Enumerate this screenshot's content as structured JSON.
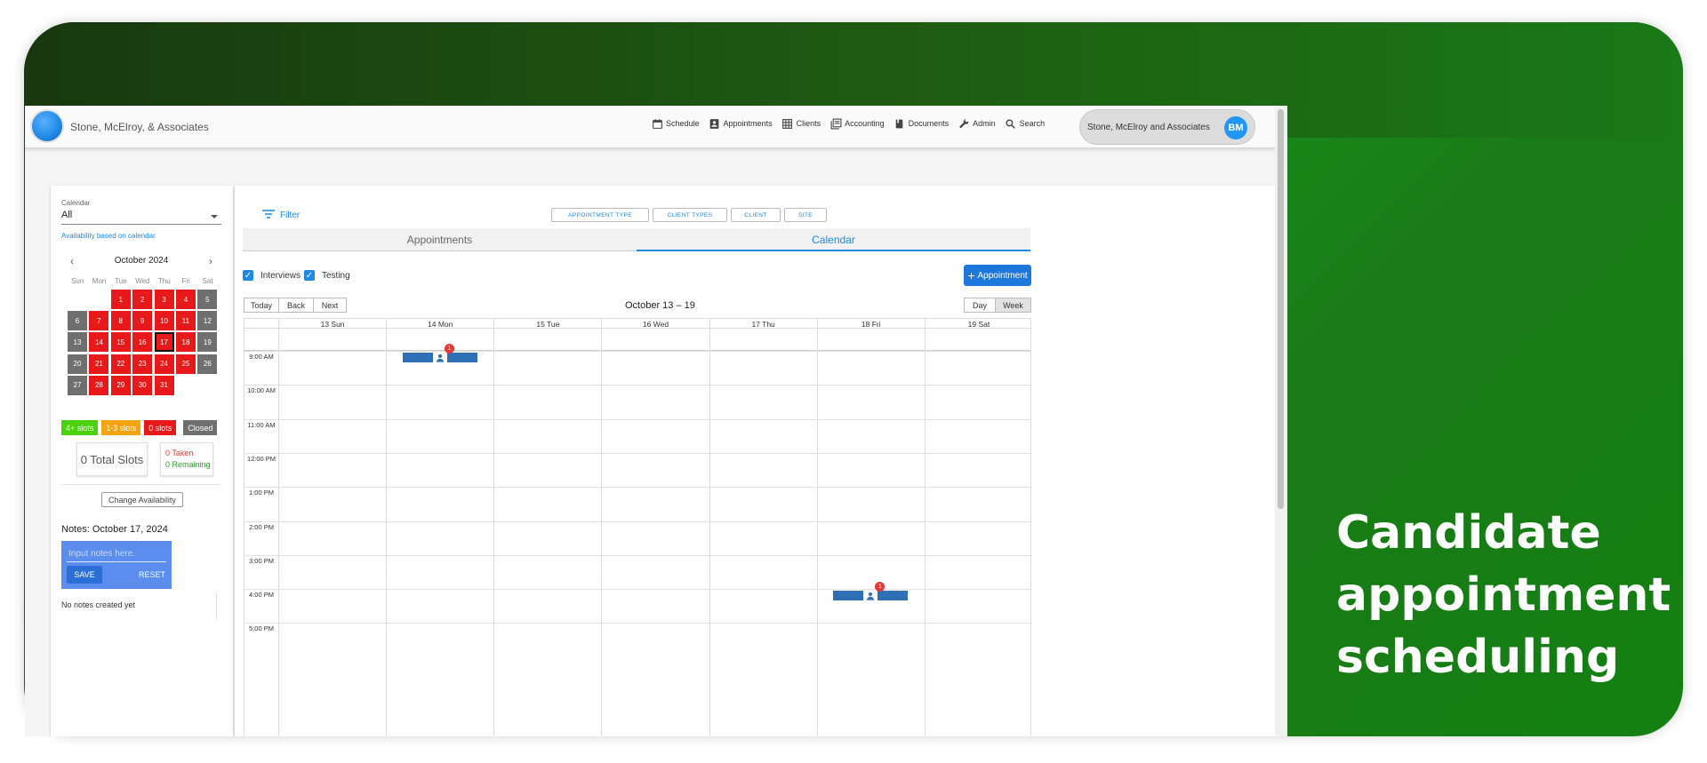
{
  "tagline": [
    "Candidate",
    "appointment",
    "scheduling"
  ],
  "header": {
    "firm_name": "Stone, McElroy, & Associates",
    "nav": [
      {
        "label": "Schedule",
        "icon": "calendar-icon"
      },
      {
        "label": "Appointments",
        "icon": "contact-card-icon"
      },
      {
        "label": "Clients",
        "icon": "grid-icon"
      },
      {
        "label": "Accounting",
        "icon": "ledger-icon"
      },
      {
        "label": "Documents",
        "icon": "book-icon"
      },
      {
        "label": "Admin",
        "icon": "wrench-icon"
      },
      {
        "label": "Search",
        "icon": "search-icon"
      }
    ],
    "account_name": "Stone, McElroy and Associates",
    "avatar_initials": "BM"
  },
  "sidebar": {
    "calendar_label": "Calendar",
    "calendar_value": "All",
    "availability_note": "Availability based on calendar",
    "month_title": "October 2024",
    "weekdays": [
      "Sun",
      "Mon",
      "Tue",
      "Wed",
      "Thu",
      "Fri",
      "Sat"
    ],
    "days": [
      {
        "n": "",
        "s": "empty"
      },
      {
        "n": "",
        "s": "empty"
      },
      {
        "n": "1",
        "s": "red"
      },
      {
        "n": "2",
        "s": "red"
      },
      {
        "n": "3",
        "s": "red"
      },
      {
        "n": "4",
        "s": "red"
      },
      {
        "n": "5",
        "s": "gray"
      },
      {
        "n": "6",
        "s": "gray"
      },
      {
        "n": "7",
        "s": "red"
      },
      {
        "n": "8",
        "s": "red"
      },
      {
        "n": "9",
        "s": "red"
      },
      {
        "n": "10",
        "s": "red"
      },
      {
        "n": "11",
        "s": "red"
      },
      {
        "n": "12",
        "s": "gray"
      },
      {
        "n": "13",
        "s": "gray"
      },
      {
        "n": "14",
        "s": "red"
      },
      {
        "n": "15",
        "s": "red"
      },
      {
        "n": "16",
        "s": "red"
      },
      {
        "n": "17",
        "s": "red",
        "selected": true
      },
      {
        "n": "18",
        "s": "red"
      },
      {
        "n": "19",
        "s": "gray"
      },
      {
        "n": "20",
        "s": "gray"
      },
      {
        "n": "21",
        "s": "red"
      },
      {
        "n": "22",
        "s": "red"
      },
      {
        "n": "23",
        "s": "red"
      },
      {
        "n": "24",
        "s": "red"
      },
      {
        "n": "25",
        "s": "red"
      },
      {
        "n": "26",
        "s": "gray"
      },
      {
        "n": "27",
        "s": "gray"
      },
      {
        "n": "28",
        "s": "red"
      },
      {
        "n": "29",
        "s": "red"
      },
      {
        "n": "30",
        "s": "red"
      },
      {
        "n": "31",
        "s": "red"
      }
    ],
    "legend": [
      {
        "label": "4+ slots",
        "color": "#4cd10f"
      },
      {
        "label": "1-3 slots",
        "color": "#f5a30f"
      },
      {
        "label": "0 slots",
        "color": "#e8191a"
      },
      {
        "label": "Closed",
        "color": "#6f6f6f"
      }
    ],
    "total_slots": "0 Total Slots",
    "taken": "0 Taken",
    "remaining": "0 Remaining",
    "change_availability": "Change Availability",
    "notes_title": "Notes: October 17, 2024",
    "notes_placeholder": "Input notes here.",
    "save_label": "SAVE",
    "reset_label": "RESET",
    "no_notes": "No notes created yet"
  },
  "main": {
    "filter_label": "Filter",
    "filter_chips": [
      "APPOINTMENT TYPE",
      "CLIENT TYPES",
      "CLIENT",
      "SITE"
    ],
    "tabs": [
      {
        "label": "Appointments",
        "active": false
      },
      {
        "label": "Calendar",
        "active": true
      }
    ],
    "checkboxes": [
      {
        "label": "Interviews",
        "checked": true
      },
      {
        "label": "Testing",
        "checked": true
      }
    ],
    "add_appointment_label": "Appointment",
    "nav_buttons": [
      "Today",
      "Back",
      "Next"
    ],
    "range_label": "October 13 – 19",
    "view_buttons": [
      {
        "label": "Day",
        "active": false
      },
      {
        "label": "Week",
        "active": true
      }
    ],
    "day_headers": [
      "13 Sun",
      "14 Mon",
      "15 Tue",
      "16 Wed",
      "17 Thu",
      "18 Fri",
      "19 Sat"
    ],
    "time_labels": [
      "9:00 AM",
      "10:00 AM",
      "11:00 AM",
      "12:00 PM",
      "1:00 PM",
      "2:00 PM",
      "3:00 PM",
      "4:00 PM",
      "5:00 PM"
    ],
    "events": [
      {
        "day_index": 1,
        "hour_index": 0,
        "count": "1",
        "color": "#2e6fb5"
      },
      {
        "day_index": 5,
        "hour_index": 7,
        "count": "1",
        "color": "#2e6fb5"
      }
    ]
  }
}
